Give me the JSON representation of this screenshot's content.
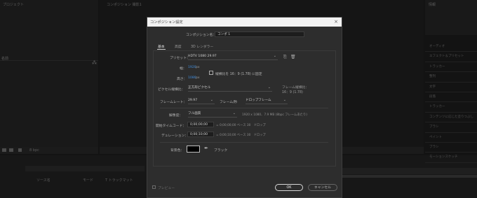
{
  "background": {
    "top_left_tab": "プロジェクト",
    "top_center_tab": "コンポジション 撮影1",
    "project_header": "名前",
    "bpc": "8 bpc",
    "timeline_header": "ソース名",
    "mode_header": "モード",
    "trackmatte_header": "T トラックマット",
    "right_panel_title": "情報",
    "right_items": [
      "オーディオ",
      "エフェクト＆プリセット",
      "トラッカー",
      "整列",
      "文字",
      "段落",
      "トラッカー",
      "コンテンツに応じた塗りつぶし",
      "ブラシ",
      "ペイント",
      "ブラシ",
      "モーションスケッチ"
    ]
  },
  "dialog": {
    "title": "コンポジション設定",
    "name_label": "コンポジション名：",
    "name_value": "コンポ 1",
    "tabs": [
      "基本",
      "高度",
      "3D レンダラー"
    ],
    "preset_label": "プリセット：",
    "preset_value": "HDTV 1080 29.97",
    "width_label": "幅：",
    "width_value": "1920",
    "width_unit": "px",
    "height_label": "高さ：",
    "height_value": "1080",
    "height_unit": "px",
    "lock_aspect_label": "縦横比を 16：9 (1.78) に固定",
    "pixel_aspect_label": "ピクセル縦横比：",
    "pixel_aspect_value": "正方形ピクセル",
    "frame_aspect_label": "フレーム縦横比：",
    "frame_aspect_value": "16：9 (1.78)",
    "framerate_label": "フレームレート：",
    "framerate_value": "29.97",
    "framerate_unit": "フレーム/秒",
    "dropframe_value": "ドロップフレーム",
    "resolution_label": "解像度：",
    "resolution_value": "フル画質",
    "resolution_info": "1920 x 1080、7.9 MB (8bpc フレームあたり)",
    "start_tc_label": "開始タイムコード：",
    "start_tc_value": "0;00;00;00",
    "start_tc_info": "= 0;00;00;00 ベース 30　ドロップ",
    "duration_label": "デュレーション：",
    "duration_value": "0;00;10;00",
    "duration_info": "= 0;00;10;00 ベース 30　ドロップ",
    "bgcolor_label": "背景色：",
    "bgcolor_name": "ブラック",
    "bgcolor_hex": "#000000",
    "preview_label": "プレビュー",
    "ok_label": "OK",
    "cancel_label": "キャンセル"
  }
}
